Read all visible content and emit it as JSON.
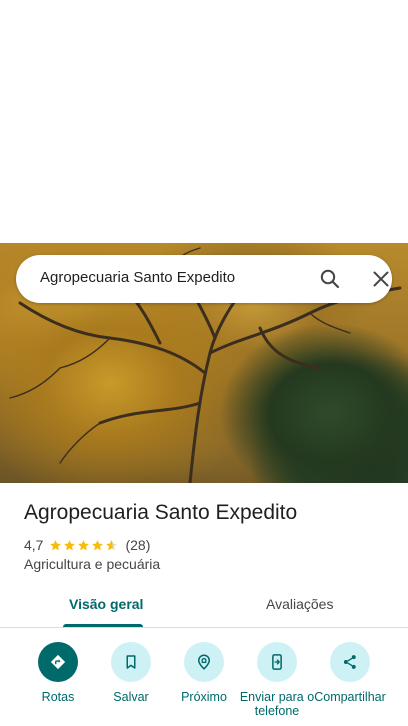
{
  "search": {
    "query": "Agropecuaria Santo Expedito"
  },
  "place": {
    "name": "Agropecuaria Santo Expedito",
    "rating": "4,7",
    "stars": 4.7,
    "reviews_count": "(28)",
    "category": "Agricultura e pecuária"
  },
  "tabs": [
    {
      "label": "Visão geral",
      "active": true
    },
    {
      "label": "Avaliações",
      "active": false
    }
  ],
  "actions": [
    {
      "label": "Rotas",
      "icon": "directions-icon"
    },
    {
      "label": "Salvar",
      "icon": "bookmark-icon"
    },
    {
      "label": "Próximo",
      "icon": "nearby-icon"
    },
    {
      "label": "Enviar para o telefone",
      "icon": "send-to-phone-icon"
    },
    {
      "label": "Compartilhar",
      "icon": "share-icon"
    }
  ],
  "colors": {
    "accent": "#006a6a",
    "action_bg": "#cdf1f4",
    "star": "#fbbc04",
    "hero_photo": "#b88a2c"
  }
}
